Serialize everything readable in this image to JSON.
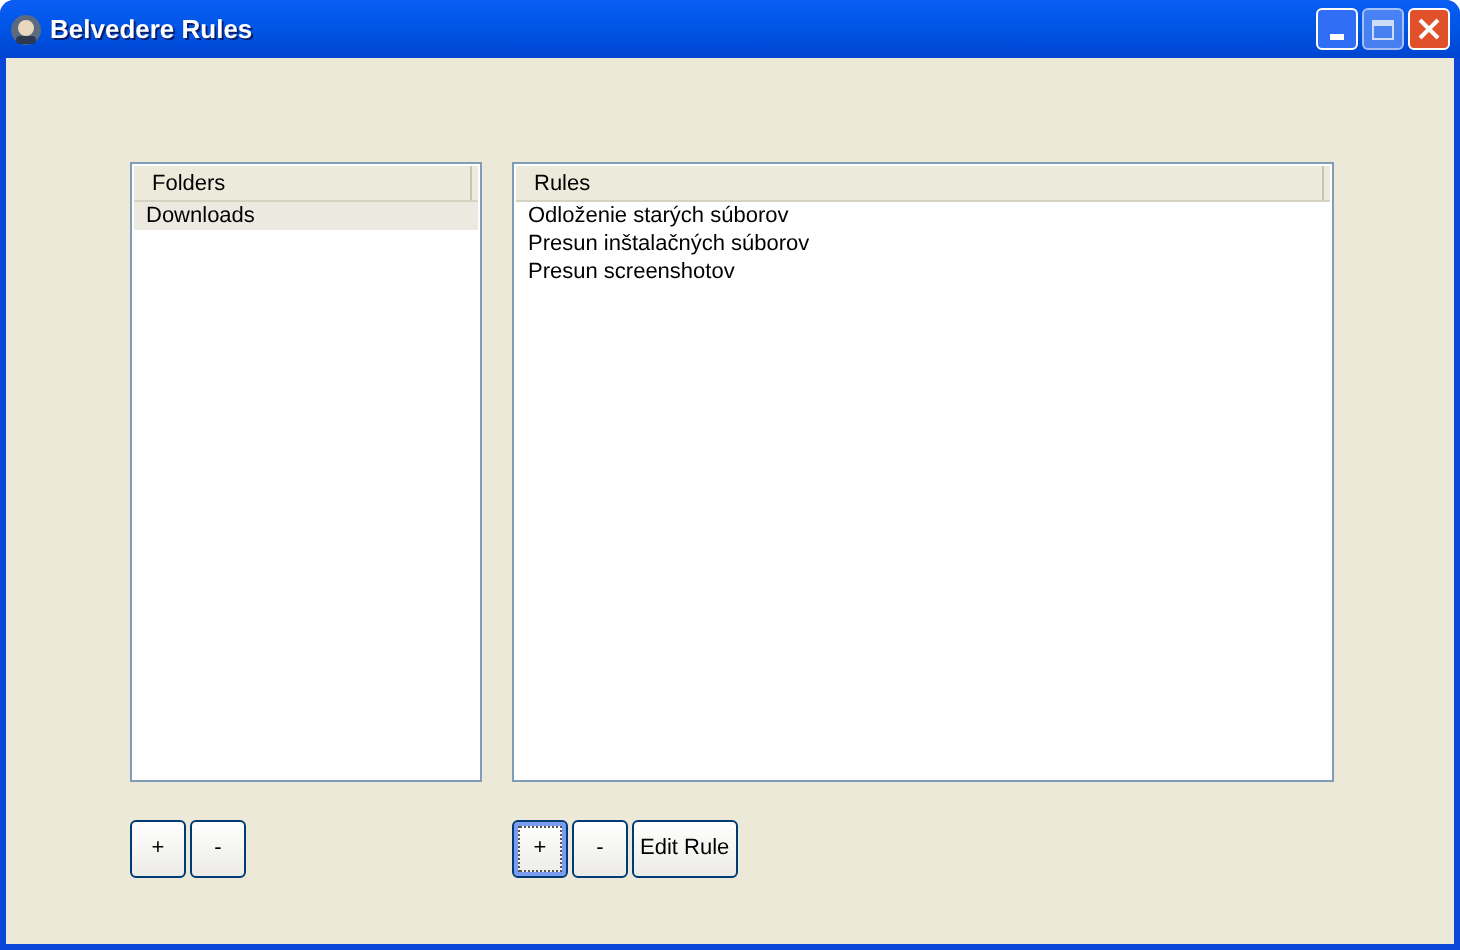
{
  "window": {
    "title": "Belvedere Rules"
  },
  "folders": {
    "column": "Folders",
    "items": [
      {
        "label": "Downloads",
        "selected": true
      }
    ]
  },
  "rules": {
    "column": "Rules",
    "items": [
      {
        "label": "Odloženie starých súborov",
        "selected": false
      },
      {
        "label": "Presun inštalačných súborov",
        "selected": false
      },
      {
        "label": "Presun screenshotov",
        "selected": false
      }
    ]
  },
  "folder_buttons": [
    {
      "label": "+",
      "focused": false
    },
    {
      "label": "-",
      "focused": false
    }
  ],
  "rule_buttons": [
    {
      "label": "+",
      "focused": true
    },
    {
      "label": "-",
      "focused": false
    },
    {
      "label": "Edit Rule",
      "focused": false
    }
  ]
}
